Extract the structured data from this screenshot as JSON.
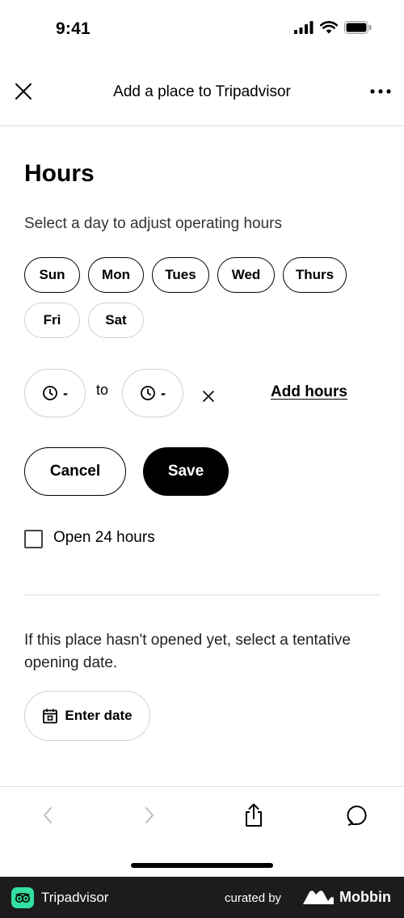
{
  "status_bar": {
    "time": "9:41"
  },
  "header": {
    "title": "Add a place to Tripadvisor"
  },
  "hours": {
    "title": "Hours",
    "subtitle": "Select a day to adjust operating hours",
    "days": [
      "Sun",
      "Mon",
      "Tues",
      "Wed",
      "Thurs",
      "Fri",
      "Sat"
    ],
    "start_time": "-",
    "to_label": "to",
    "end_time": "-",
    "add_hours_label": "Add hours",
    "cancel_label": "Cancel",
    "save_label": "Save",
    "open24_label": "Open 24 hours",
    "open24_checked": false
  },
  "opening": {
    "info": "If this place hasn't opened yet, select a tentative opening date.",
    "enter_date_label": "Enter date"
  },
  "footer": {
    "brand": "Tripadvisor",
    "curated_by": "curated by",
    "mobbin": "Mobbin"
  },
  "colors": {
    "accent": "#000000",
    "brand_green": "#34e0a1",
    "footer_bg": "#1c1c1c"
  }
}
